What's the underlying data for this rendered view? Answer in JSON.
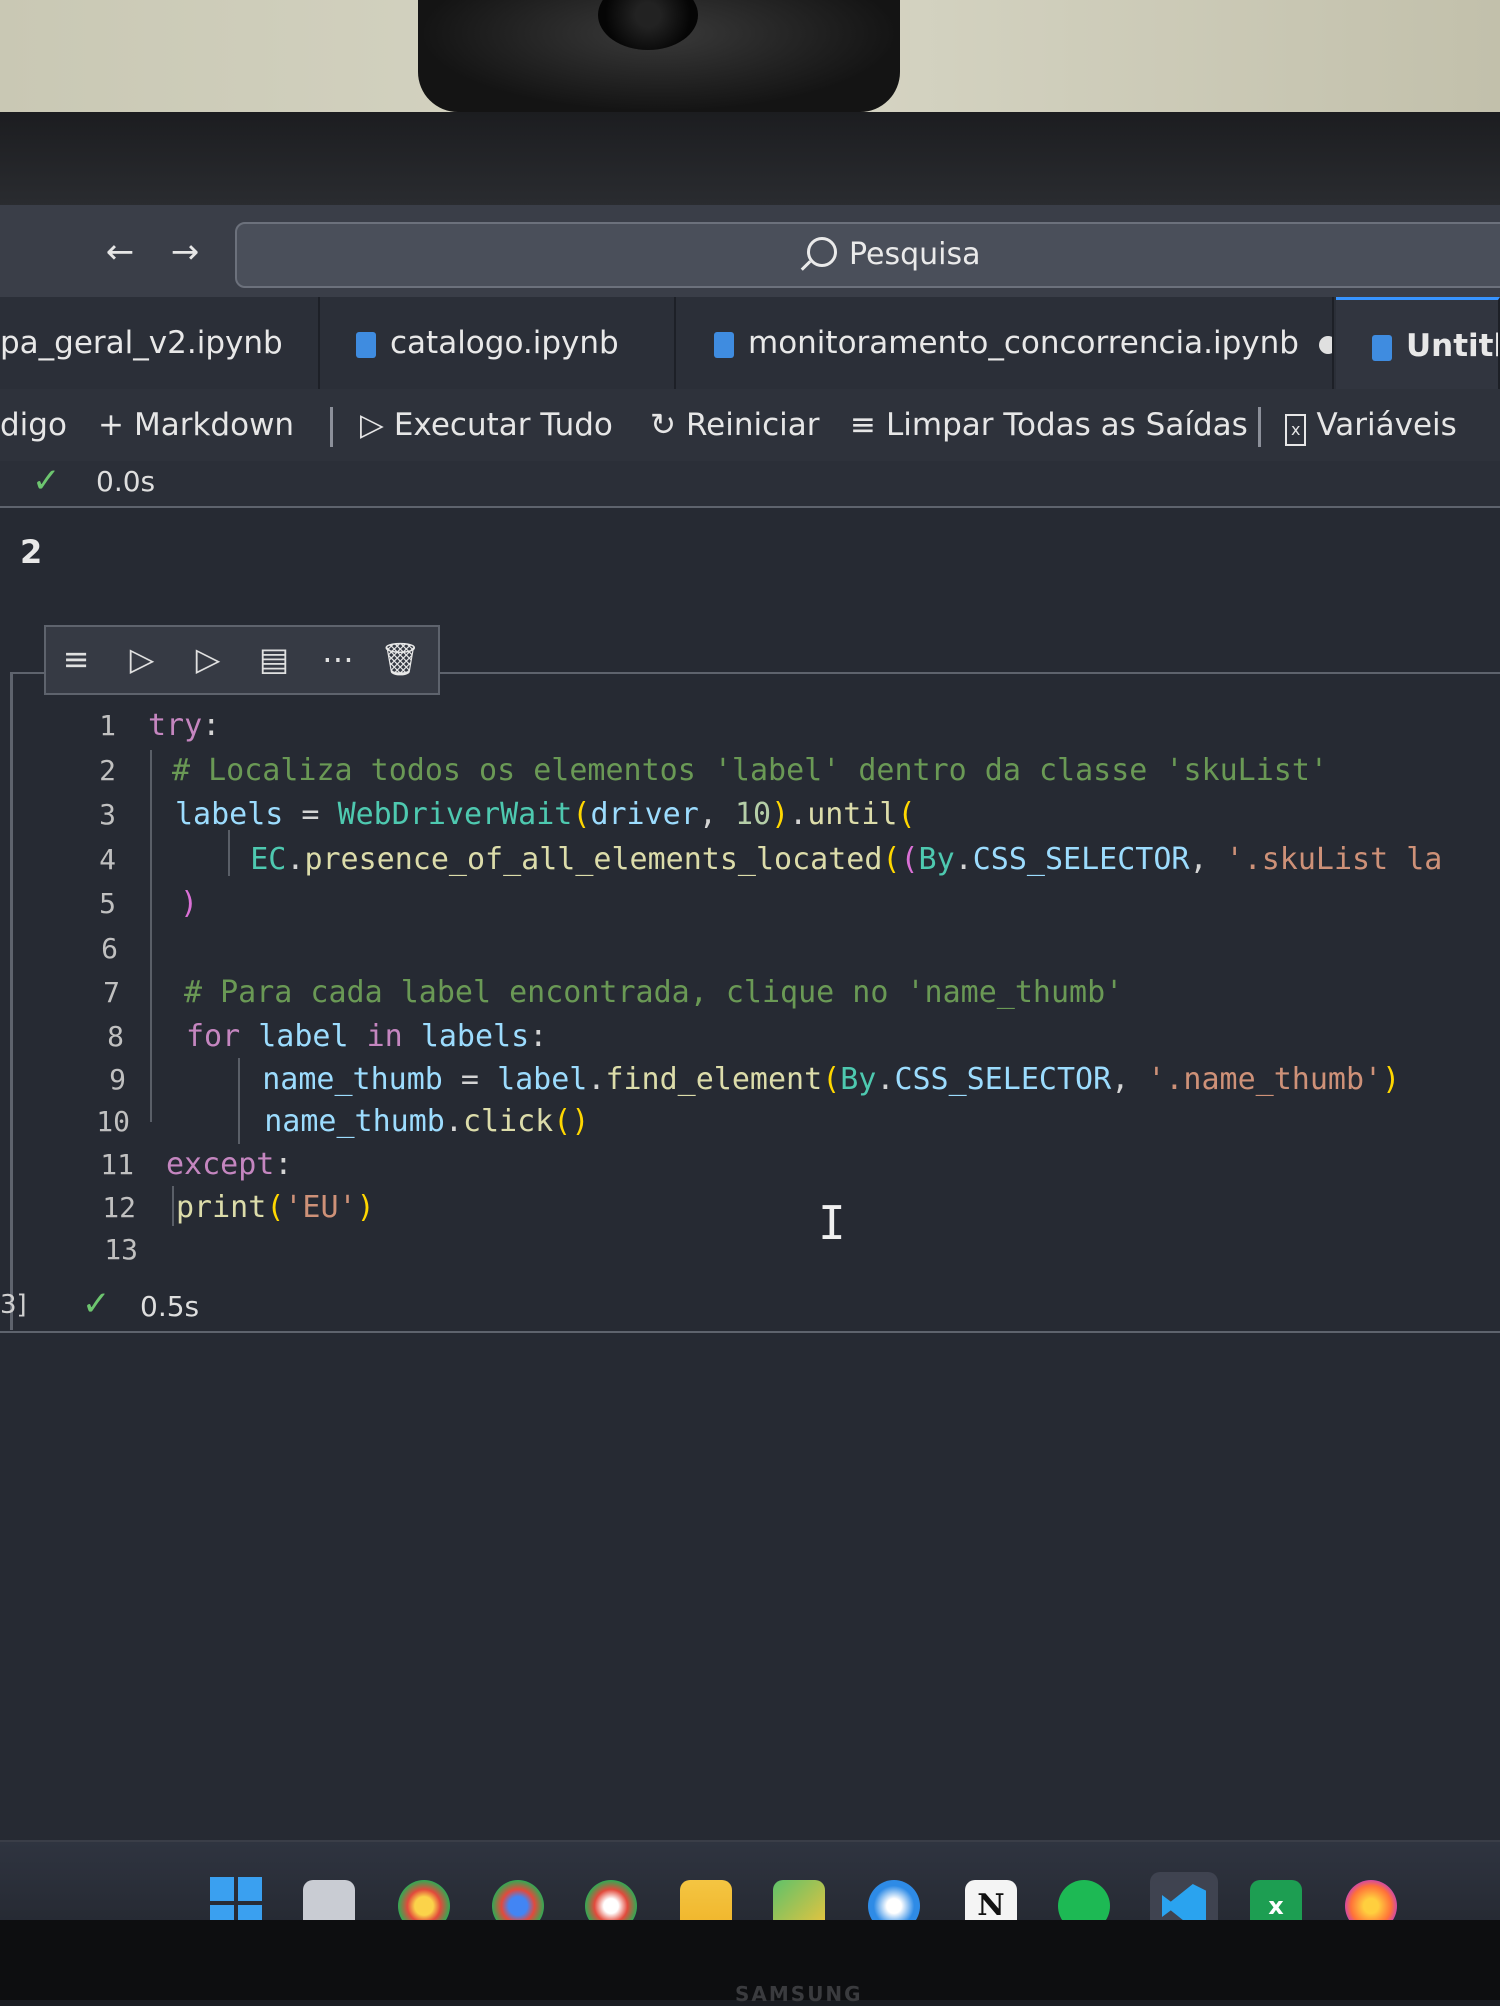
{
  "browser": {
    "search_placeholder": "Pesquisa"
  },
  "tabs": [
    {
      "label": "pa_geral_v2.ipynb",
      "active": false,
      "dirty": false
    },
    {
      "label": "catalogo.ipynb",
      "active": false,
      "dirty": false
    },
    {
      "label": "monitoramento_concorrencia.ipynb",
      "active": false,
      "dirty": true
    },
    {
      "label": "Untitl",
      "active": true,
      "dirty": false
    }
  ],
  "toolbar": {
    "code_label": "digo",
    "markdown_label": "Markdown",
    "run_all_label": "Executar Tudo",
    "restart_label": "Reiniciar",
    "clear_outputs_label": "Limpar Todas as Saídas",
    "variables_label": "Variáveis"
  },
  "previous_cell": {
    "duration": "0.0s",
    "output": "2"
  },
  "cell_toolbar_icons": [
    "run-by-line-icon",
    "execute-above-icon",
    "execute-below-icon",
    "split-cell-icon",
    "more-icon",
    "delete-icon"
  ],
  "code_cell": {
    "line_numbers": [
      "1",
      "2",
      "3",
      "4",
      "5",
      "6",
      "7",
      "8",
      "9",
      "10",
      "11",
      "12",
      "13"
    ],
    "lines": [
      "try:",
      "    # Localiza todos os elementos 'label' dentro da classe 'skuList'",
      "    labels = WebDriverWait(driver, 10).until(",
      "        EC.presence_of_all_elements_located((By.CSS_SELECTOR, '.skuList la",
      "    )",
      "",
      "    # Para cada label encontrada, clique no 'name_thumb'",
      "    for label in labels:",
      "        name_thumb = label.find_element(By.CSS_SELECTOR, '.name_thumb')",
      "        name_thumb.click()",
      "except:",
      "    print('EU')",
      ""
    ],
    "exec_count": "3]",
    "duration": "0.5s"
  },
  "taskbar": {
    "apps": [
      "windows-start",
      "task-view",
      "chrome-profile-1",
      "chrome-profile-2",
      "chrome-profile-3",
      "file-explorer",
      "chat",
      "browser",
      "notion",
      "spotify",
      "vscode",
      "excel",
      "firefox"
    ]
  },
  "monitor_brand": "SAMSUNG",
  "colors": {
    "accent": "#3794ff",
    "check_green": "#6dc56f",
    "editor_bg": "#262a33"
  }
}
